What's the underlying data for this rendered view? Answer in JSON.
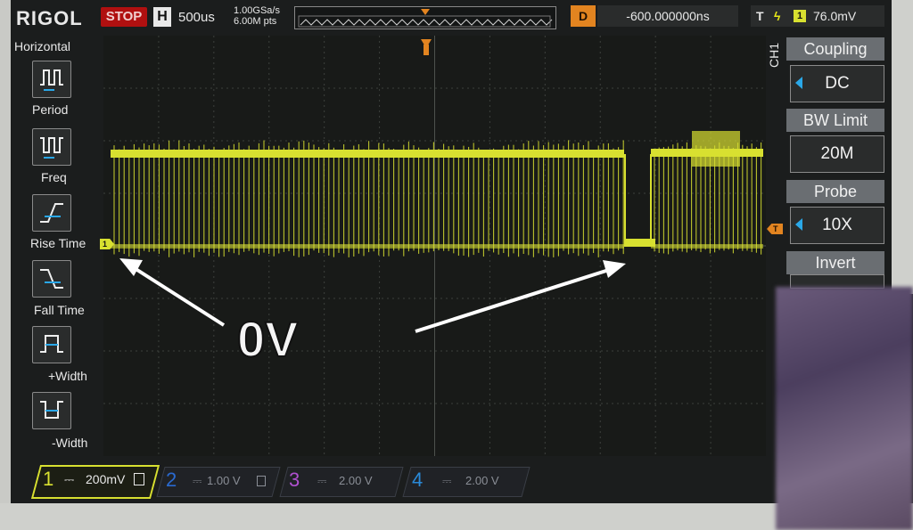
{
  "brand": {
    "logo": "RIGOL"
  },
  "status": {
    "run_state": "STOP"
  },
  "timebase": {
    "h_label": "H",
    "value": "500us",
    "sample_rate": "1.00GSa/s",
    "memory_depth": "6.00M pts"
  },
  "delay": {
    "d_label": "D",
    "value": "-600.000000ns"
  },
  "trigger": {
    "t_label": "T",
    "edge_symbol": "ϟ",
    "source": "1",
    "level": "76.0mV"
  },
  "left_menu": {
    "title": "Horizontal",
    "items": [
      {
        "label": "Period",
        "icon": "period-icon"
      },
      {
        "label": "Freq",
        "icon": "frequency-icon"
      },
      {
        "label": "Rise Time",
        "icon": "rise-time-icon"
      },
      {
        "label": "Fall Time",
        "icon": "fall-time-icon"
      },
      {
        "label": "+Width",
        "icon": "positive-width-icon"
      },
      {
        "label": "-Width",
        "icon": "negative-width-icon"
      }
    ]
  },
  "right_menu": {
    "channel": "CH1",
    "items": [
      {
        "header": "Coupling",
        "value": "DC"
      },
      {
        "header": "BW Limit",
        "value": "20M"
      },
      {
        "header": "Probe",
        "value": "10X"
      },
      {
        "header": "Invert",
        "value": ""
      }
    ]
  },
  "channels": [
    {
      "num": "1",
      "coupling_symbol": "⎓",
      "scale": "200mV",
      "color": "#d8e030",
      "active": true
    },
    {
      "num": "2",
      "coupling_symbol": "⎓",
      "scale": "1.00 V",
      "color": "#2a6ad0",
      "active": false
    },
    {
      "num": "3",
      "coupling_symbol": "⎓",
      "scale": "2.00 V",
      "color": "#b050d0",
      "active": false
    },
    {
      "num": "4",
      "coupling_symbol": "⎓",
      "scale": "2.00 V",
      "color": "#2a8ad8",
      "active": false
    }
  ],
  "markers": {
    "ch1_ground": "1",
    "trigger_level": "T",
    "trigger_position": "T"
  },
  "annotation": {
    "text": "0V"
  },
  "colors": {
    "trace": "#d8e030",
    "grid": "#4a4e4a",
    "accent_orange": "#e28420",
    "stop_red": "#b01010"
  }
}
